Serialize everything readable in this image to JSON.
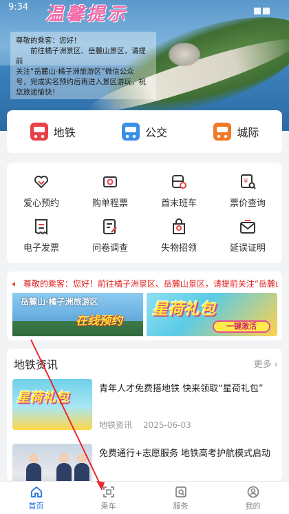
{
  "status_bar": {
    "time": "9:34"
  },
  "hero": {
    "title": "温馨提示",
    "notice_lines": [
      "尊敬的乘客：您好！",
      "　　前往橘子洲景区、岳麓山景区，请提前",
      "关注“岳麓山·橘子洲旅游区”微信公众",
      "号，完成实名预约后再进入景区游玩，祝",
      "您旅途愉快！"
    ]
  },
  "transport": {
    "items": [
      {
        "label": "地铁",
        "color": "#e8414a"
      },
      {
        "label": "公交",
        "color": "#3b8fe6"
      },
      {
        "label": "城际",
        "color": "#f07a28"
      }
    ]
  },
  "services": {
    "items": [
      {
        "label": "爱心预约",
        "icon": "heart-hand-icon"
      },
      {
        "label": "购单程票",
        "icon": "ticket-icon"
      },
      {
        "label": "首末班车",
        "icon": "train-clock-icon"
      },
      {
        "label": "票价查询",
        "icon": "yen-search-icon"
      },
      {
        "label": "电子发票",
        "icon": "invoice-icon"
      },
      {
        "label": "问卷调查",
        "icon": "survey-icon"
      },
      {
        "label": "失物招领",
        "icon": "lost-found-icon"
      },
      {
        "label": "延误证明",
        "icon": "delay-mail-icon"
      }
    ]
  },
  "promo": {
    "ticker": "尊敬的乘客：您好！前往橘子洲景区、岳麓山景区，请提前关注“岳麓山·橘子洲旅游区”微信公众号",
    "banner_left": {
      "title": "岳麓山·橘子洲旅游区",
      "subtitle": "在线预约"
    },
    "banner_right": {
      "title": "星荷礼包",
      "button": "一键激活"
    }
  },
  "news": {
    "header": "地铁资讯",
    "more": "更多",
    "items": [
      {
        "title": "青年人才免费搭地铁 快来领取“星荷礼包”",
        "thumb_text": "星荷礼包",
        "source": "地铁资讯",
        "date": "2025-06-03"
      },
      {
        "title": "免费通行+志愿服务 地铁高考护航模式启动",
        "source": "",
        "date": ""
      }
    ]
  },
  "tabbar": {
    "items": [
      {
        "label": "首页",
        "active": true
      },
      {
        "label": "乘车",
        "active": false
      },
      {
        "label": "服务",
        "active": false
      },
      {
        "label": "我的",
        "active": false
      }
    ]
  },
  "colors": {
    "accent": "#1d6fe0",
    "alert": "#e02020"
  }
}
